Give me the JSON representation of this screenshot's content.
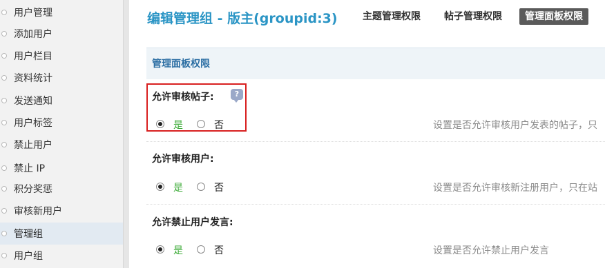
{
  "sidebar": {
    "items": [
      {
        "label": "用户管理"
      },
      {
        "label": "添加用户"
      },
      {
        "label": "用户栏目"
      },
      {
        "label": "资料统计"
      },
      {
        "label": "发送通知"
      },
      {
        "label": "用户标签"
      },
      {
        "label": "禁止用户"
      },
      {
        "label": "禁止 IP"
      },
      {
        "label": "积分奖惩"
      },
      {
        "label": "审核新用户"
      },
      {
        "label": "管理组",
        "active": true
      },
      {
        "label": "用户组"
      }
    ]
  },
  "header": {
    "title": "编辑管理组 - 版主(groupid:3)",
    "tabs": [
      {
        "label": "主题管理权限"
      },
      {
        "label": "帖子管理权限"
      },
      {
        "label": "管理面板权限",
        "active": true
      }
    ]
  },
  "section": {
    "title": "管理面板权限"
  },
  "settings": [
    {
      "label": "允许审核帖子:",
      "help_icon": "question-bubble-icon",
      "yes": "是",
      "no": "否",
      "selected": "yes",
      "description": "设置是否允许审核用户发表的帖子，只"
    },
    {
      "label": "允许审核用户:",
      "yes": "是",
      "no": "否",
      "selected": "yes",
      "description": "设置是否允许审核新注册用户，只在站"
    },
    {
      "label": "允许禁止用户发言:",
      "yes": "是",
      "no": "否",
      "selected": "yes",
      "description": "设置是否允许禁止用户发言"
    }
  ],
  "colors": {
    "accent": "#2b95c5",
    "yes_label": "#3aaa35",
    "highlight": "#d81e1e",
    "active_tab": "#5a5a5a"
  }
}
